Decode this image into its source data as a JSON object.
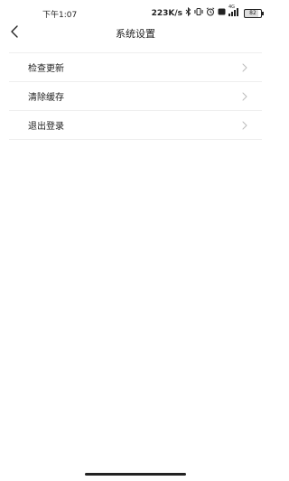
{
  "status_bar": {
    "time": "下午1:07",
    "network_speed": "223K/s",
    "network_type": "4G",
    "battery_label": "82",
    "battery_level": 0.82,
    "icons": [
      "bluetooth-icon",
      "vibrate-icon",
      "alarm-icon",
      "hd-icon",
      "4g-signal-icon",
      "battery-icon"
    ]
  },
  "header": {
    "title": "系统设置",
    "back_icon": "chevron-left-icon"
  },
  "menu": {
    "items": [
      {
        "label": "检查更新",
        "icon": "chevron-right-icon"
      },
      {
        "label": "清除缓存",
        "icon": "chevron-right-icon"
      },
      {
        "label": "退出登录",
        "icon": "chevron-right-icon"
      }
    ]
  },
  "colors": {
    "background": "#ffffff",
    "text": "#222222",
    "divider": "#eeeeee",
    "chevron": "#bbbbbb"
  }
}
